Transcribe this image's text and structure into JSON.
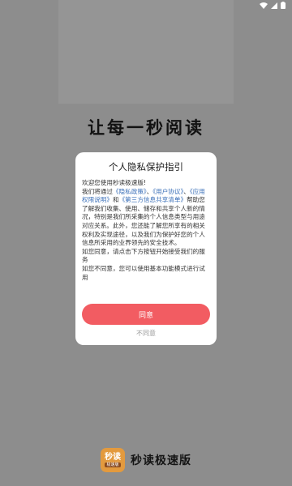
{
  "status_bar": {
    "icons": [
      "wifi-icon",
      "signal-icon",
      "battery-icon"
    ]
  },
  "splash": {
    "slogan": "让每一秒阅读"
  },
  "dialog": {
    "title": "个人隐私保护指引",
    "body": {
      "p1_a": "欢迎您使用秒读极速版!",
      "p1_b": "我们将通过",
      "link_privacy": "《隐私政策》",
      "sep1": "、",
      "link_user": "《用户协议》",
      "sep2": "、",
      "link_permission": "《应用权限说明》",
      "and": "和",
      "link_thirdparty": "《第三方信息共享清单》",
      "p1_c": "帮助您了解我们收集、使用、储存和共享个人新的情况，特别是我们所采集的个人信息类型与用途对应关系。此外，您还能了解您所享有的相关权利及实现途径，以及我们为保护好您的个人信息所采用的业界领先的安全技术。",
      "p2": "如您同意，请点击下方按钮开始接受我们的服务",
      "p3": "如您不同意，您可以使用基本功能模式进行试用"
    },
    "agree_label": "同意",
    "disagree_label": "不同意"
  },
  "brand": {
    "icon_text": "秒读",
    "icon_subtext": "极速版",
    "name": "秒读极速版",
    "accent_color": "#e39a3e"
  },
  "colors": {
    "overlay": "#8d8d8d",
    "agree_button": "#f25c62",
    "link": "#3a6fb8"
  }
}
